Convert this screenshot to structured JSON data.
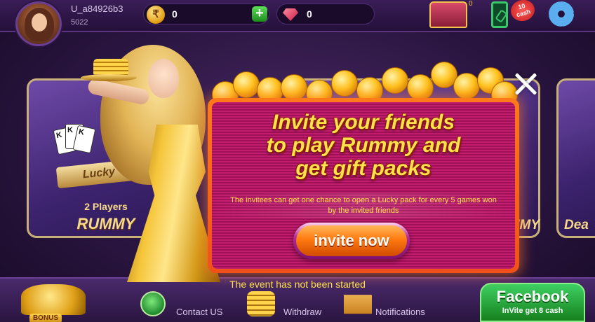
{
  "header": {
    "username": "U_a84926b3",
    "user_id": "5022",
    "coin_symbol": "₹",
    "coin_balance": "0",
    "add_symbol": "+",
    "gem_balance": "0",
    "chest_count": "0",
    "cash_badge": "10\ncash"
  },
  "games": {
    "left_sub": "2 Players",
    "left_title": "RUMMY",
    "left_ribbon": "Lucky",
    "mid_label": "UMMY",
    "right_label": "Dea"
  },
  "dialog": {
    "title": "Invite your friends\nto play Rummy and\nget gift packs",
    "description": "The invitees can get one chance to open a Lucky pack for every 5 games won by the invited friends",
    "invite_label": "invite now"
  },
  "event_status": "The event has not been started",
  "bottom_nav": {
    "bonus_label": "BONUS",
    "contact": "Contact US",
    "withdraw": "Withdraw",
    "notifications": "Notifications",
    "facebook_title": "Facebook",
    "facebook_sub": "InVite get 8 cash"
  },
  "colors": {
    "accent_yellow": "#ffe14a",
    "dialog_orange": "#f1501a",
    "dialog_pink": "#c21e6e",
    "facebook_green": "#2aa840"
  }
}
